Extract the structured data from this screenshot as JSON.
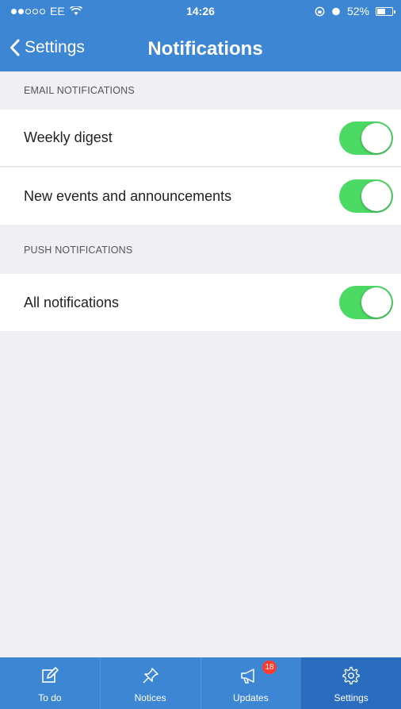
{
  "status_bar": {
    "carrier": "EE",
    "time": "14:26",
    "battery": "52%"
  },
  "nav": {
    "back_label": "Settings",
    "title": "Notifications"
  },
  "sections": [
    {
      "header": "EMAIL NOTIFICATIONS",
      "rows": [
        {
          "label": "Weekly digest",
          "enabled": true
        },
        {
          "label": "New events and announcements",
          "enabled": true
        }
      ]
    },
    {
      "header": "PUSH NOTIFICATIONS",
      "rows": [
        {
          "label": "All notifications",
          "enabled": true
        }
      ]
    }
  ],
  "tab_bar": {
    "active": "Settings",
    "tabs": [
      {
        "label": "To do",
        "icon": "edit-icon"
      },
      {
        "label": "Notices",
        "icon": "pin-icon"
      },
      {
        "label": "Updates",
        "icon": "megaphone-icon",
        "badge": "18"
      },
      {
        "label": "Settings",
        "icon": "gear-icon"
      }
    ]
  },
  "colors": {
    "brand": "#3d86d4",
    "active_tab": "#2a6dbf",
    "toggle_on": "#4cd964",
    "badge": "#ff3b30",
    "background": "#efeff4"
  }
}
